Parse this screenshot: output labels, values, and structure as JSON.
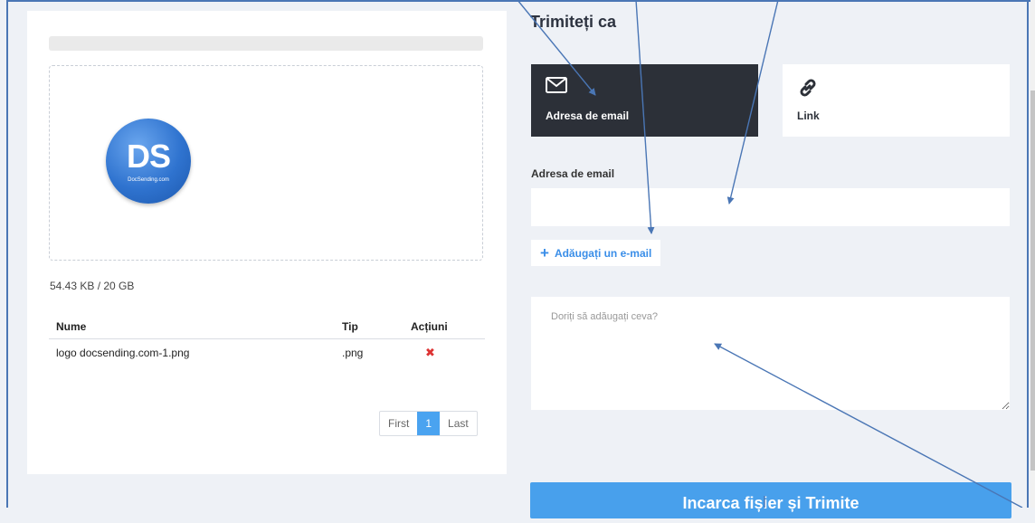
{
  "upload": {
    "logo_mark": "DS",
    "logo_caption": "DocSending.com",
    "quota": "54.43 KB / 20 GB",
    "table": {
      "headers": [
        "Nume",
        "Tip",
        "Acțiuni"
      ],
      "rows": [
        {
          "name": "logo docsending.com-1.png",
          "type": ".png",
          "action_icon": "remove-icon",
          "action_glyph": "✖"
        }
      ]
    },
    "pagination": {
      "first": "First",
      "current": "1",
      "last": "Last"
    }
  },
  "send": {
    "title": "Trimiteți ca",
    "options": [
      {
        "label": "Adresa de email",
        "icon": "envelope-icon",
        "selected": true
      },
      {
        "label": "Link",
        "icon": "link-icon",
        "selected": false
      }
    ],
    "email_label": "Adresa de email",
    "email_value": "",
    "add_email": "Adăugați un e-mail",
    "message_placeholder": "Doriți să adăugați ceva?",
    "submit": "Incarca fișier și Trimite"
  },
  "colors": {
    "accent": "#48a0ec",
    "dark_card": "#2c3038",
    "annotation": "#4a76b5",
    "background": "#eef1f6"
  }
}
